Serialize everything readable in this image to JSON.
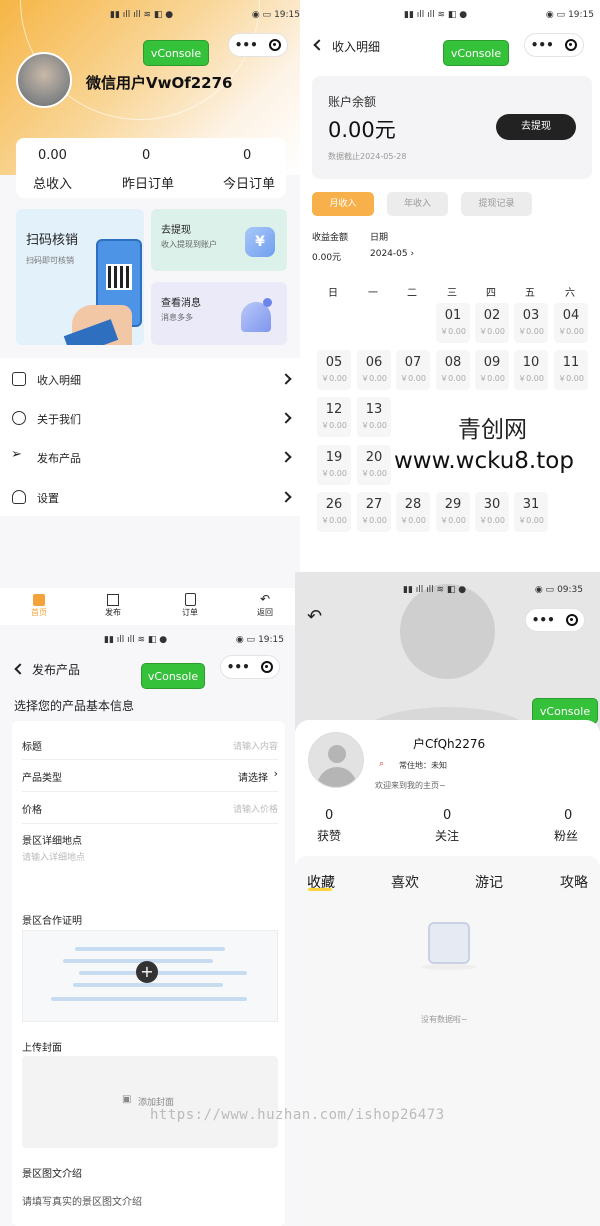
{
  "status": {
    "time_a": "19:15",
    "time_b": "19:15",
    "time_c": "19:15",
    "time_d": "09:35"
  },
  "vconsole": "vConsole",
  "home": {
    "username": "微信用户VwOf2276",
    "stats": [
      {
        "value": "0.00",
        "label": "总收入"
      },
      {
        "value": "0",
        "label": "昨日订单"
      },
      {
        "value": "0",
        "label": "今日订单"
      }
    ],
    "scan": {
      "title": "扫码核销",
      "sub": "扫码即可核销"
    },
    "withdraw": {
      "title": "去提现",
      "sub": "收入提现到账户"
    },
    "message": {
      "title": "查看消息",
      "sub": "消息多多"
    },
    "menu": [
      {
        "label": "收入明细",
        "icon": "document-icon"
      },
      {
        "label": "关于我们",
        "icon": "info-icon"
      },
      {
        "label": "发布产品",
        "icon": "send-icon"
      },
      {
        "label": "设置",
        "icon": "user-settings-icon"
      }
    ],
    "tabbar": [
      {
        "label": "首页",
        "icon": "home-icon"
      },
      {
        "label": "发布",
        "icon": "building-icon"
      },
      {
        "label": "订单",
        "icon": "clipboard-icon"
      },
      {
        "label": "返回",
        "icon": "return-icon"
      }
    ]
  },
  "income": {
    "title": "收入明细",
    "balance_label": "账户余额",
    "balance": "0.00元",
    "withdraw_btn": "去提现",
    "date_note": "数据截止2024-05-28",
    "tabs": [
      "月收入",
      "年收入",
      "提现记录"
    ],
    "amount_label": "收益金额",
    "amount": "0.00元",
    "date_label": "日期",
    "date_value": "2024-05",
    "weekdays": [
      "日",
      "一",
      "二",
      "三",
      "四",
      "五",
      "六"
    ],
    "days": [
      "01",
      "02",
      "03",
      "04",
      "05",
      "06",
      "07",
      "08",
      "09",
      "10",
      "11",
      "12",
      "13",
      "19",
      "20",
      "26",
      "27",
      "28",
      "29",
      "30",
      "31"
    ],
    "day_amount": "￥0.00"
  },
  "watermark": {
    "name": "青创网",
    "url": "www.wcku8.top",
    "bottom": "https://www.huzhan.com/ishop26473"
  },
  "publish": {
    "title": "发布产品",
    "section": "选择您的产品基本信息",
    "fields": [
      {
        "label": "标题",
        "placeholder": "请输入内容"
      },
      {
        "label": "产品类型",
        "value": "请选择"
      },
      {
        "label": "价格",
        "placeholder": "请输入价格"
      }
    ],
    "address_label": "景区详细地点",
    "address_placeholder": "请输入详细地点",
    "coop_label": "景区合作证明",
    "cover_label": "上传封面",
    "cover_btn": "添加封面",
    "intro_label": "景区图文介绍",
    "intro_placeholder": "请填写真实的景区图文介绍"
  },
  "profile": {
    "name": "户CfQh2276",
    "residence": "常住地：未知",
    "welcome": "欢迎来到我的主页~",
    "stats": [
      {
        "value": "0",
        "label": "获赞"
      },
      {
        "value": "0",
        "label": "关注"
      },
      {
        "value": "0",
        "label": "粉丝"
      }
    ],
    "tabs": [
      "收藏",
      "喜欢",
      "游记",
      "攻略"
    ],
    "empty": "没有数据啦~"
  }
}
